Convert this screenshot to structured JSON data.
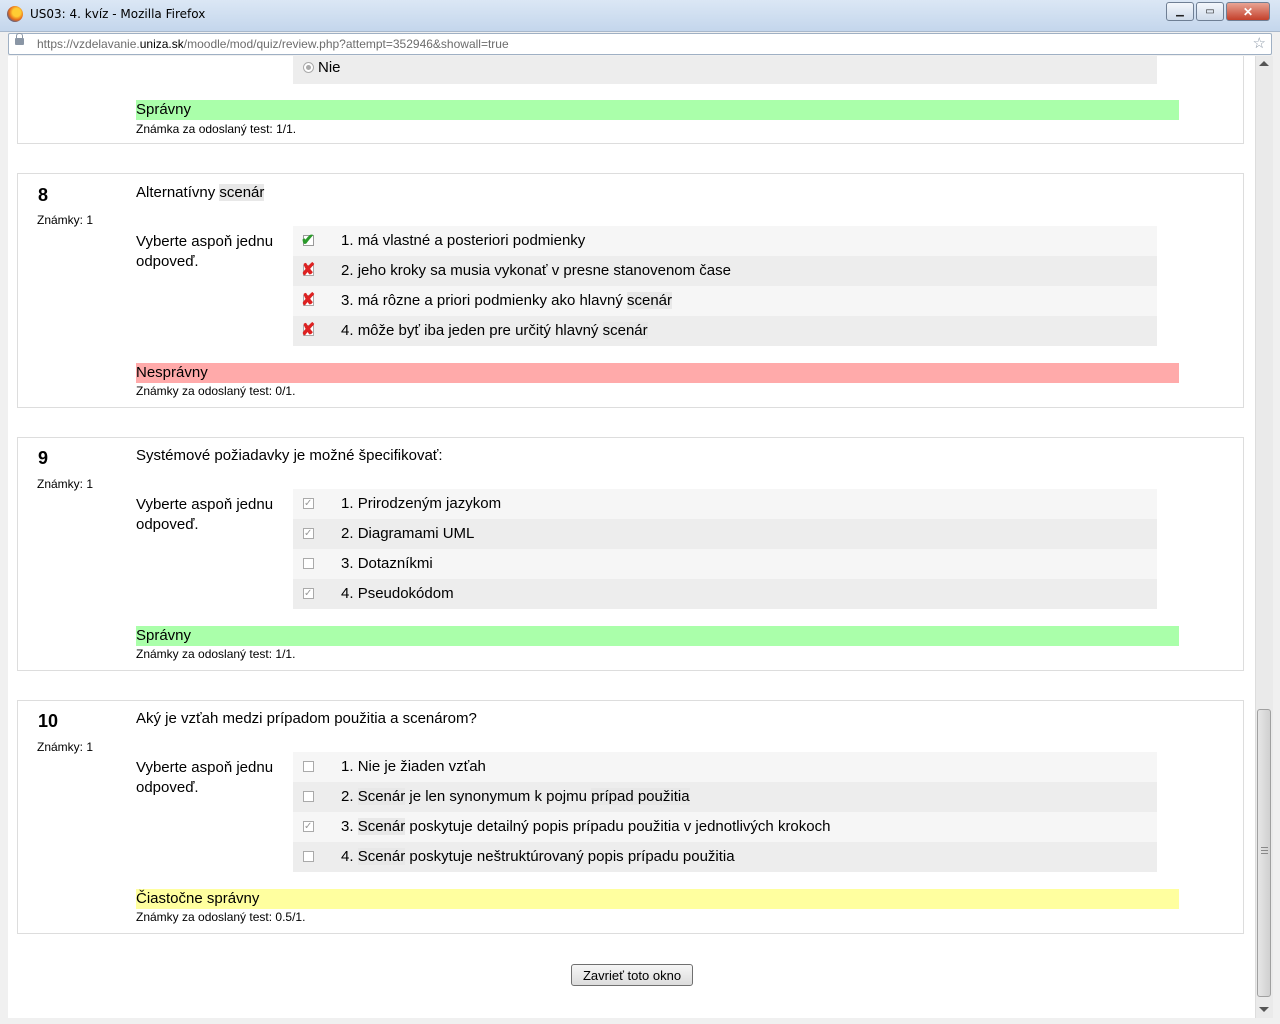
{
  "window": {
    "title": "US03: 4. kvíz - Mozilla Firefox",
    "url_prefix": "https://vzdelavanie.",
    "url_domain": "uniza.sk",
    "url_suffix": "/moodle/mod/quiz/review.php?attempt=352946&showall=true"
  },
  "colors": {
    "correct": "#aaffaa",
    "incorrect": "#ffaaaa",
    "partial": "#ffff9f"
  },
  "prev_question": {
    "option_label": "Nie",
    "outcome": "Správny",
    "grade": "Známka za odoslaný test: 1/1."
  },
  "questions": [
    {
      "number": "8",
      "marks": "Známky: 1",
      "text_before": "Alternatívny ",
      "text_hl": "scenár",
      "prompt": "Vyberte aspoň jednu odpoveď.",
      "answers": [
        {
          "num": "1.",
          "text": "má vlastné a posteriori podmienky",
          "mark": "correct-checked"
        },
        {
          "num": "2.",
          "text": "jeho kroky sa musia vykonať v presne stanovenom čase",
          "mark": "incorrect-checked"
        },
        {
          "num": "3.",
          "text_before": "má rôzne a priori podmienky ako hlavný ",
          "text_hl": "scenár",
          "mark": "incorrect-checked"
        },
        {
          "num": "4.",
          "text_before": "môže byť iba jeden pre určitý hlavný ",
          "text_hl": "scenár",
          "mark": "incorrect-checked"
        }
      ],
      "outcome": "Nesprávny",
      "grade": "Známky za odoslaný test: 0/1."
    },
    {
      "number": "9",
      "marks": "Známky: 1",
      "text": "Systémové požiadavky je možné špecifikovať:",
      "prompt": "Vyberte aspoň jednu odpoveď.",
      "answers": [
        {
          "num": "1.",
          "text": "Prirodzeným jazykom",
          "checked": true
        },
        {
          "num": "2.",
          "text": "Diagramami UML",
          "checked": true
        },
        {
          "num": "3.",
          "text": "Dotazníkmi",
          "checked": false
        },
        {
          "num": "4.",
          "text": "Pseudokódom",
          "checked": true
        }
      ],
      "outcome": "Správny",
      "grade": "Známky za odoslaný test: 1/1."
    },
    {
      "number": "10",
      "marks": "Známky: 1",
      "text": "Aký je vzťah medzi prípadom použitia a scenárom?",
      "prompt": "Vyberte aspoň jednu odpoveď.",
      "answers": [
        {
          "num": "1.",
          "text": "Nie je žiaden vzťah",
          "checked": false
        },
        {
          "num": "2.",
          "hl1": "Scenár",
          "mid": " je len synonymum k pojmu ",
          "hl2": "prípad použitia",
          "checked": false
        },
        {
          "num": "3.",
          "hl1": "Scenár",
          "mid": " poskytuje detailný popis prípadu použitia v jednotlivých krokoch",
          "checked": true
        },
        {
          "num": "4.",
          "hl1": "Scenár",
          "mid": " poskytuje neštruktúrovaný popis prípadu použitia",
          "checked": false
        }
      ],
      "outcome": "Čiastočne správny",
      "grade": "Známky za odoslaný test: 0.5/1."
    }
  ],
  "close_button": "Zavrieť toto okno"
}
